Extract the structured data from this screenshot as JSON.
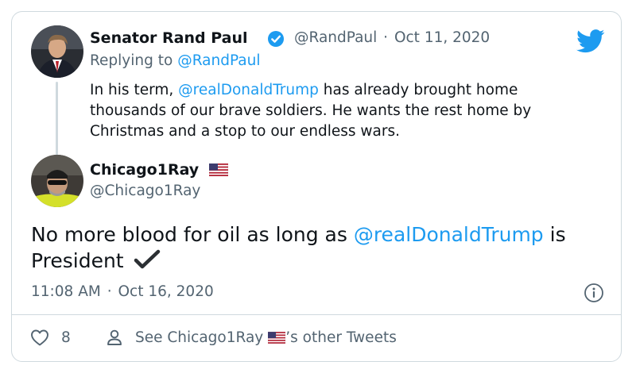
{
  "parent": {
    "name": "Senator Rand Paul",
    "handle": "@RandPaul",
    "separator": "·",
    "date": "Oct 11, 2020",
    "replying_prefix": "Replying to",
    "replying_handle": "@RandPaul",
    "text_line1_a": "In his term,",
    "mention": "@realDonaldTrump",
    "text_line1_b": "has already brought home",
    "text_line2": "thousands of our brave soldiers. He wants the rest home by",
    "text_line3": "Christmas and a stop to our endless wars."
  },
  "reply": {
    "name": "Chicago1Ray",
    "handle": "@Chicago1Ray",
    "text_a": "No more blood for oil as long as",
    "mention": "@realDonaldTrump",
    "text_b": "is",
    "text_line2": "President",
    "time": "11:08 AM",
    "separator": "·",
    "date": "Oct 16, 2020"
  },
  "footer": {
    "likes": "8",
    "see_prefix": "See Chicago1Ray",
    "see_suffix": "’s other Tweets"
  },
  "colors": {
    "link": "#1d9bf0",
    "twitter_blue": "#1d9bf0",
    "verified": "#1d9bf0",
    "secondary_text": "#536471"
  }
}
